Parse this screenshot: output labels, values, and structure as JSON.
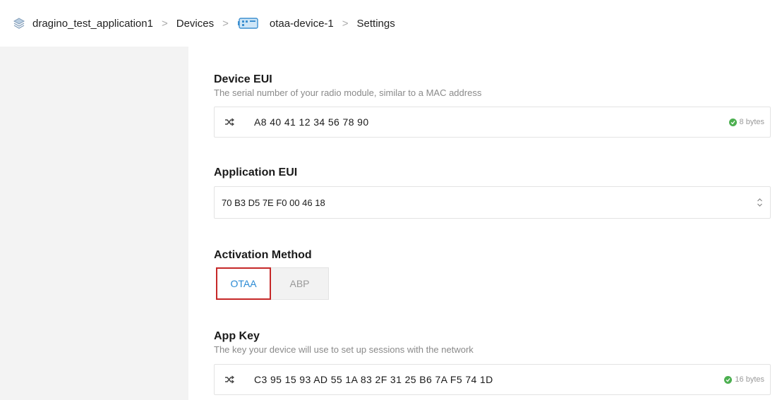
{
  "breadcrumb": {
    "items": [
      {
        "label": "dragino_test_application1",
        "icon": "stack-icon"
      },
      {
        "label": "Devices"
      },
      {
        "label": "otaa-device-1",
        "icon": "device-icon"
      },
      {
        "label": "Settings"
      }
    ],
    "separator": ">"
  },
  "device_eui": {
    "label": "Device EUI",
    "description": "The serial number of your radio module, similar to a MAC address",
    "value": "A8 40 41 12 34 56 78 90",
    "byte_count": "8 bytes",
    "icon": "shuffle-icon"
  },
  "application_eui": {
    "label": "Application EUI",
    "value": "70 B3 D5 7E F0 00 46 18",
    "icon": "select-arrows-icon"
  },
  "activation_method": {
    "label": "Activation Method",
    "options": [
      "OTAA",
      "ABP"
    ],
    "selected": "OTAA"
  },
  "app_key": {
    "label": "App Key",
    "description": "The key your device will use to set up sessions with the network",
    "value": "C3 95 15 93 AD 55 1A 83 2F 31 25 B6 7A F5 74 1D",
    "byte_count": "16 bytes",
    "icon": "shuffle-icon"
  },
  "colors": {
    "accent": "#2a8ad4",
    "highlight_border": "#c62828",
    "valid": "#4caf50",
    "sidebar_bg": "#f3f3f3"
  }
}
